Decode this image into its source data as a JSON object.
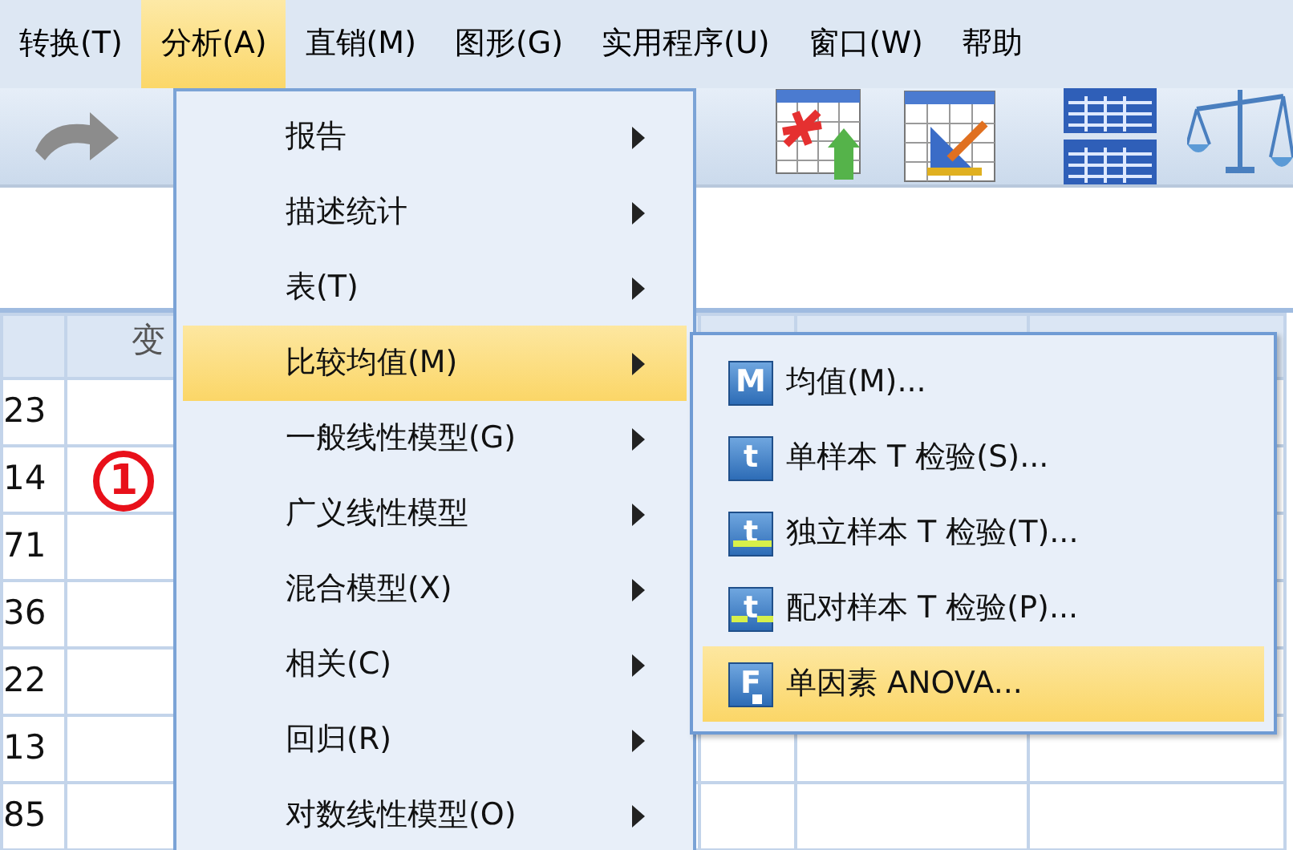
{
  "menubar": [
    {
      "label": "转换(T)",
      "selected": false
    },
    {
      "label": "分析(A)",
      "selected": true
    },
    {
      "label": "直销(M)",
      "selected": false
    },
    {
      "label": "图形(G)",
      "selected": false
    },
    {
      "label": "实用程序(U)",
      "selected": false
    },
    {
      "label": "窗口(W)",
      "selected": false
    },
    {
      "label": "帮助",
      "selected": false
    }
  ],
  "grid": {
    "columns": [
      "",
      "变",
      "",
      "",
      ""
    ],
    "rows": [
      "23",
      "14",
      "71",
      "36",
      "22",
      "13",
      "85"
    ]
  },
  "analyze_menu": [
    {
      "label": "报告",
      "selected": false
    },
    {
      "label": "描述统计",
      "selected": false
    },
    {
      "label": "表(T)",
      "selected": false
    },
    {
      "label": "比较均值(M)",
      "selected": true
    },
    {
      "label": "一般线性模型(G)",
      "selected": false
    },
    {
      "label": "广义线性模型",
      "selected": false
    },
    {
      "label": "混合模型(X)",
      "selected": false
    },
    {
      "label": "相关(C)",
      "selected": false
    },
    {
      "label": "回归(R)",
      "selected": false
    },
    {
      "label": "对数线性模型(O)",
      "selected": false
    }
  ],
  "compare_means_menu": [
    {
      "label": "均值(M)...",
      "icon_label": "M",
      "kind": "plain",
      "selected": false
    },
    {
      "label": "单样本 T 检验(S)...",
      "icon_label": "t",
      "kind": "plain",
      "selected": false
    },
    {
      "label": "独立样本 T 检验(T)...",
      "icon_label": "t",
      "kind": "independent",
      "selected": false
    },
    {
      "label": "配对样本 T 检验(P)...",
      "icon_label": "t",
      "kind": "paired",
      "selected": false
    },
    {
      "label": "单因素 ANOVA...",
      "icon_label": "F",
      "kind": "anova",
      "selected": true
    }
  ],
  "annotation": {
    "label": "1"
  }
}
